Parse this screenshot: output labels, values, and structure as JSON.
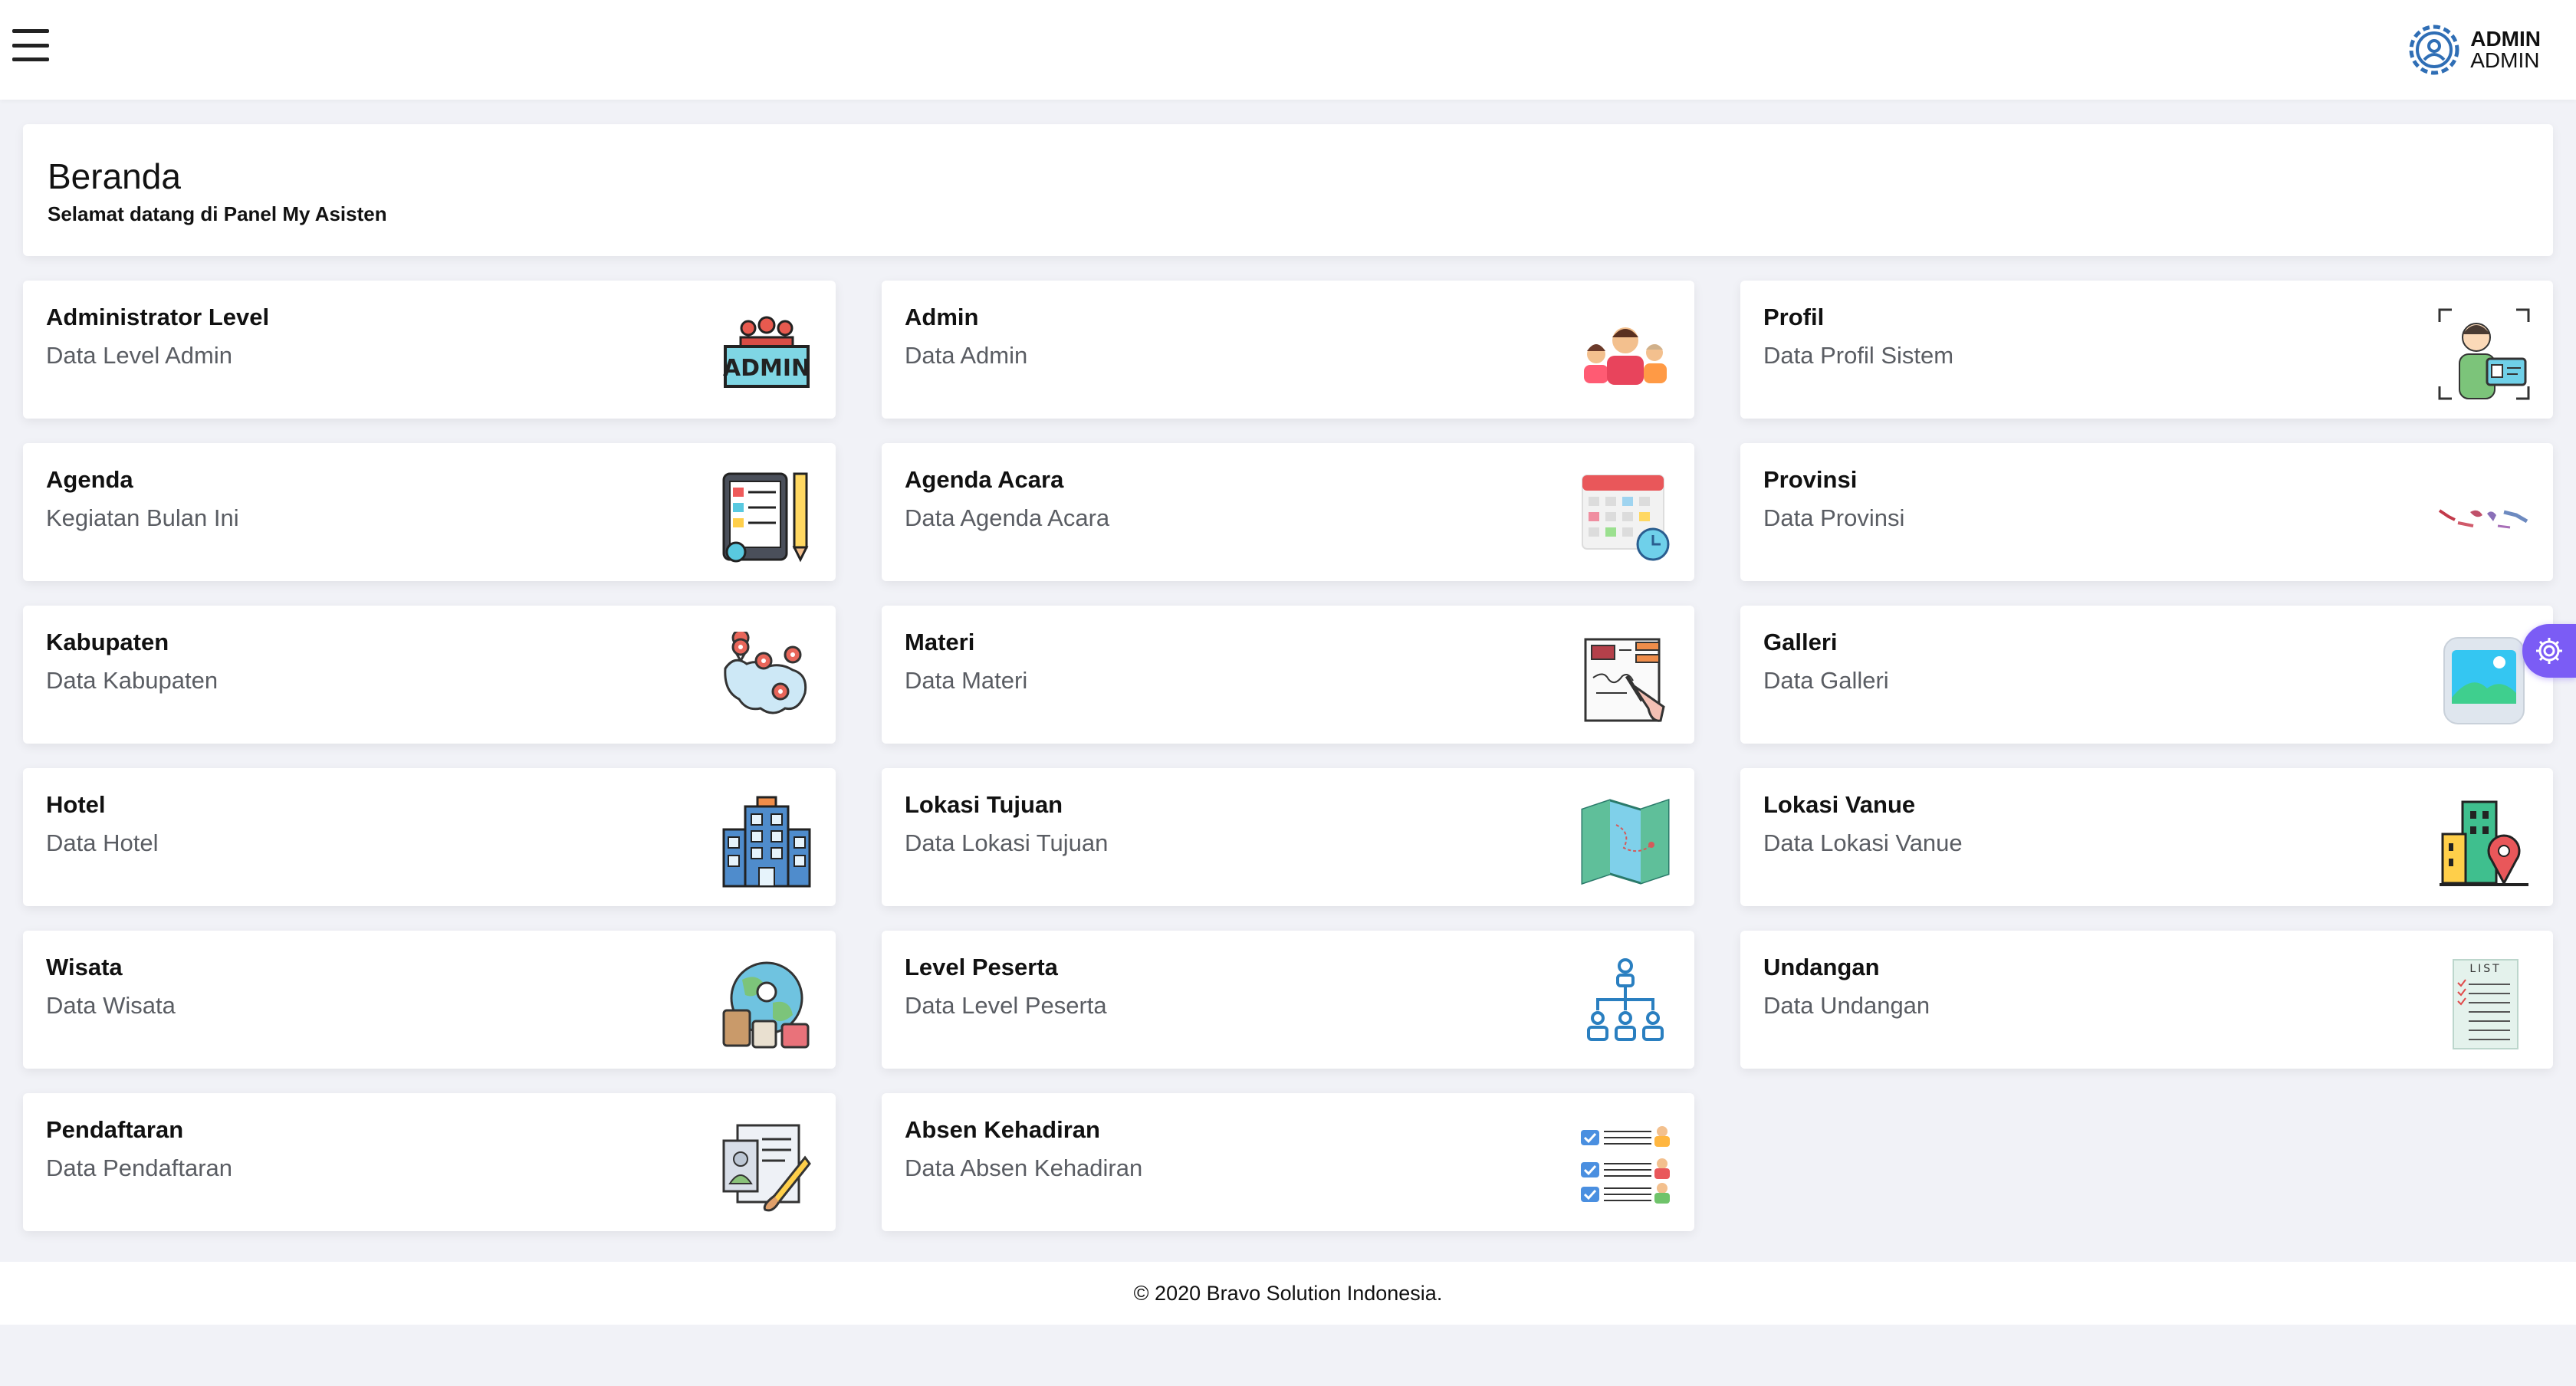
{
  "topbar": {
    "menu_icon": "hamburger-menu-icon",
    "user_name": "ADMIN",
    "user_role": "ADMIN",
    "avatar_icon": "user-gear-icon"
  },
  "header": {
    "title": "Beranda",
    "subtitle": "Selamat datang di Panel My Asisten"
  },
  "cards": [
    {
      "title": "Administrator Level",
      "desc": "Data Level Admin",
      "icon": "admin-group-icon"
    },
    {
      "title": "Admin",
      "desc": "Data Admin",
      "icon": "admin-people-icon"
    },
    {
      "title": "Profil",
      "desc": "Data Profil Sistem",
      "icon": "profile-id-icon"
    },
    {
      "title": "Agenda",
      "desc": "Kegiatan Bulan Ini",
      "icon": "agenda-tablet-icon"
    },
    {
      "title": "Agenda Acara",
      "desc": "Data Agenda Acara",
      "icon": "calendar-clock-icon"
    },
    {
      "title": "Provinsi",
      "desc": "Data Provinsi",
      "icon": "indonesia-map-icon"
    },
    {
      "title": "Kabupaten",
      "desc": "Data Kabupaten",
      "icon": "map-pins-icon"
    },
    {
      "title": "Materi",
      "desc": "Data Materi",
      "icon": "document-pen-icon"
    },
    {
      "title": "Galleri",
      "desc": "Data Galleri",
      "icon": "image-gallery-icon"
    },
    {
      "title": "Hotel",
      "desc": "Data Hotel",
      "icon": "hotel-building-icon"
    },
    {
      "title": "Lokasi Tujuan",
      "desc": "Data Lokasi Tujuan",
      "icon": "folded-map-icon"
    },
    {
      "title": "Lokasi Vanue",
      "desc": "Data Lokasi Vanue",
      "icon": "building-location-icon"
    },
    {
      "title": "Wisata",
      "desc": "Data Wisata",
      "icon": "travel-globe-icon"
    },
    {
      "title": "Level Peserta",
      "desc": "Data Level Peserta",
      "icon": "hierarchy-icon"
    },
    {
      "title": "Undangan",
      "desc": "Data Undangan",
      "icon": "checklist-icon"
    },
    {
      "title": "Pendaftaran",
      "desc": "Data Pendaftaran",
      "icon": "registration-form-icon"
    },
    {
      "title": "Absen Kehadiran",
      "desc": "Data Absen Kehadiran",
      "icon": "attendance-list-icon"
    }
  ],
  "footer": {
    "text": "© 2020 Bravo Solution Indonesia."
  },
  "settings_tab": {
    "icon": "gear-icon",
    "color": "#7b5cf5"
  }
}
